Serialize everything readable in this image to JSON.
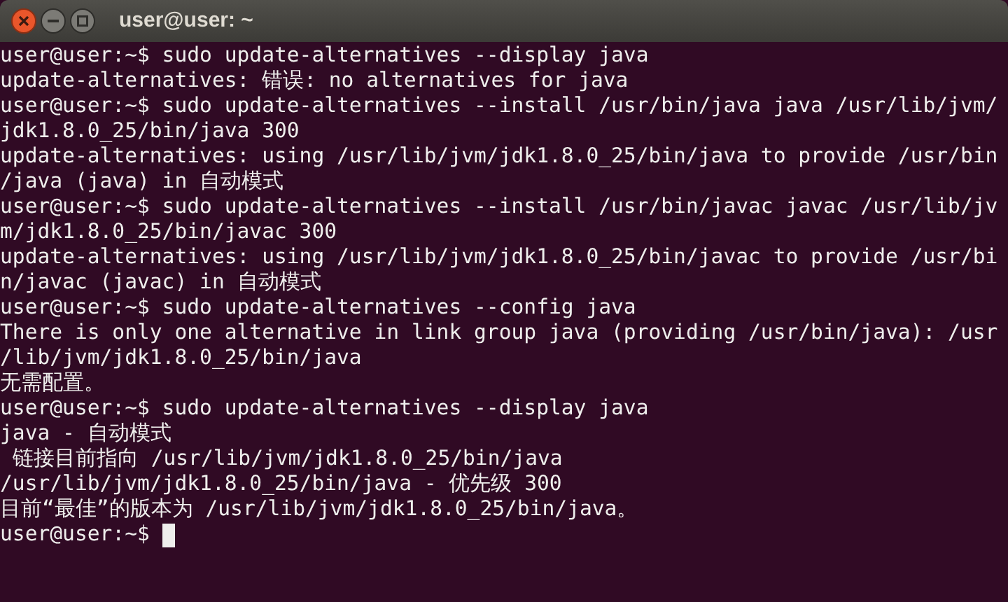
{
  "window": {
    "title": "user@user: ~"
  },
  "lines": [
    "user@user:~$ sudo update-alternatives --display java",
    "update-alternatives: 错误: no alternatives for java",
    "user@user:~$ sudo update-alternatives --install /usr/bin/java java /usr/lib/jvm/",
    "jdk1.8.0_25/bin/java 300",
    "update-alternatives: using /usr/lib/jvm/jdk1.8.0_25/bin/java to provide /usr/bin",
    "/java (java) in 自动模式",
    "user@user:~$ sudo update-alternatives --install /usr/bin/javac javac /usr/lib/jv",
    "m/jdk1.8.0_25/bin/javac 300",
    "update-alternatives: using /usr/lib/jvm/jdk1.8.0_25/bin/javac to provide /usr/bi",
    "n/javac (javac) in 自动模式",
    "user@user:~$ sudo update-alternatives --config java",
    "There is only one alternative in link group java (providing /usr/bin/java): /usr",
    "/lib/jvm/jdk1.8.0_25/bin/java",
    "无需配置。",
    "user@user:~$ sudo update-alternatives --display java",
    "java - 自动模式",
    " 链接目前指向 /usr/lib/jvm/jdk1.8.0_25/bin/java",
    "/usr/lib/jvm/jdk1.8.0_25/bin/java - 优先级 300",
    "目前“最佳”的版本为 /usr/lib/jvm/jdk1.8.0_25/bin/java。"
  ],
  "prompt": {
    "text": "user@user:~$",
    "cursor": true
  }
}
